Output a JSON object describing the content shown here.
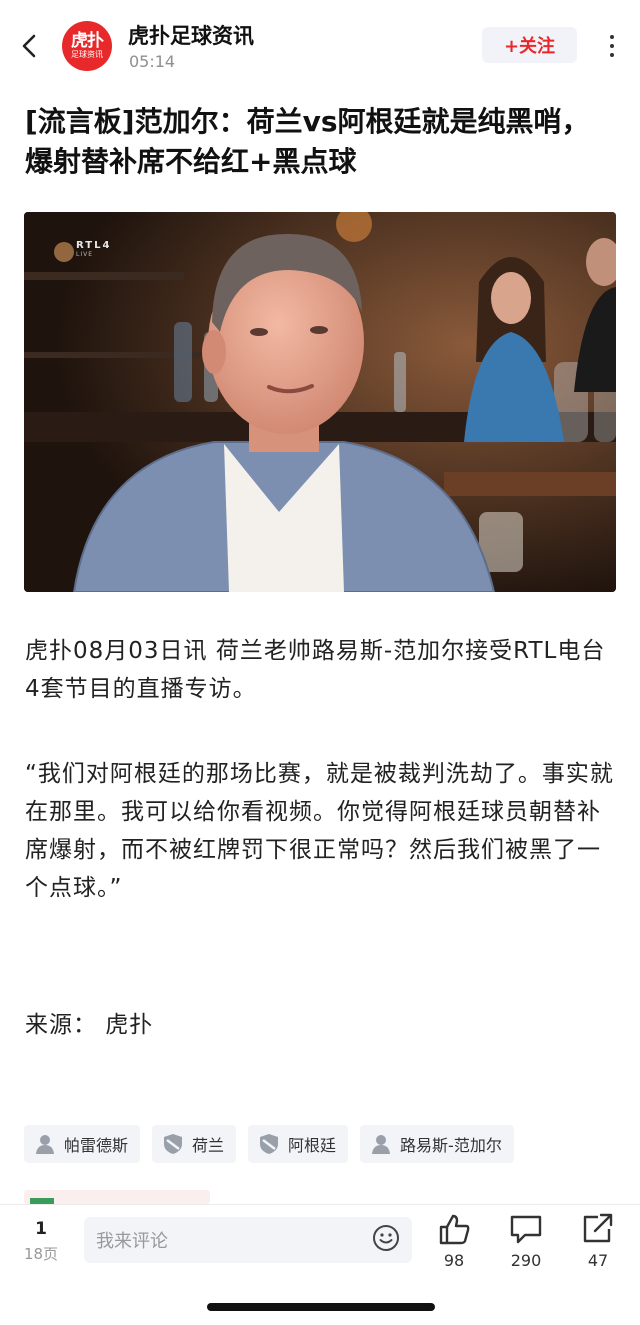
{
  "header": {
    "account_name": "虎扑足球资讯",
    "time": "05:14",
    "avatar_line1": "虎扑",
    "avatar_line2": "足球资讯",
    "follow_label": "+关注",
    "icons": [
      "back-arrow-icon",
      "more-icon"
    ]
  },
  "article": {
    "title": "[流言板]范加尔：荷兰vs阿根廷就是纯黑哨，爆射替补席不给红+黑点球",
    "photo_overlay_logo": "RTL4",
    "photo_overlay_sub": "LIVE",
    "paragraph1": "虎扑08月03日讯 荷兰老帅路易斯-范加尔接受RTL电台4套节目的直播专访。",
    "paragraph2": "“我们对阿根廷的那场比赛，就是被裁判洗劫了。事实就在那里。我可以给你看视频。你觉得阿根廷球员朝替补席爆射，而不被红牌罚下很正常吗？然后我们被黑了一个点球。”",
    "source": "来源： 虎扑"
  },
  "tags": [
    {
      "label": "帕雷德斯",
      "icon": "person-icon"
    },
    {
      "label": "荷兰",
      "icon": "shield-icon"
    },
    {
      "label": "阿根廷",
      "icon": "shield-icon"
    },
    {
      "label": "路易斯-范加尔",
      "icon": "person-icon"
    }
  ],
  "bottom_bar": {
    "page_number": "1",
    "page_total": "18页",
    "comment_placeholder": "我来评论",
    "like_count": "98",
    "comment_count": "290",
    "share_count": "47",
    "icons": [
      "emoji-icon",
      "thumbs-up-icon",
      "comment-icon",
      "share-icon"
    ]
  },
  "colors": {
    "brand_red": "#e8292b",
    "tag_bg": "#f3f4f7",
    "follow_bg": "#f1f3f9"
  }
}
